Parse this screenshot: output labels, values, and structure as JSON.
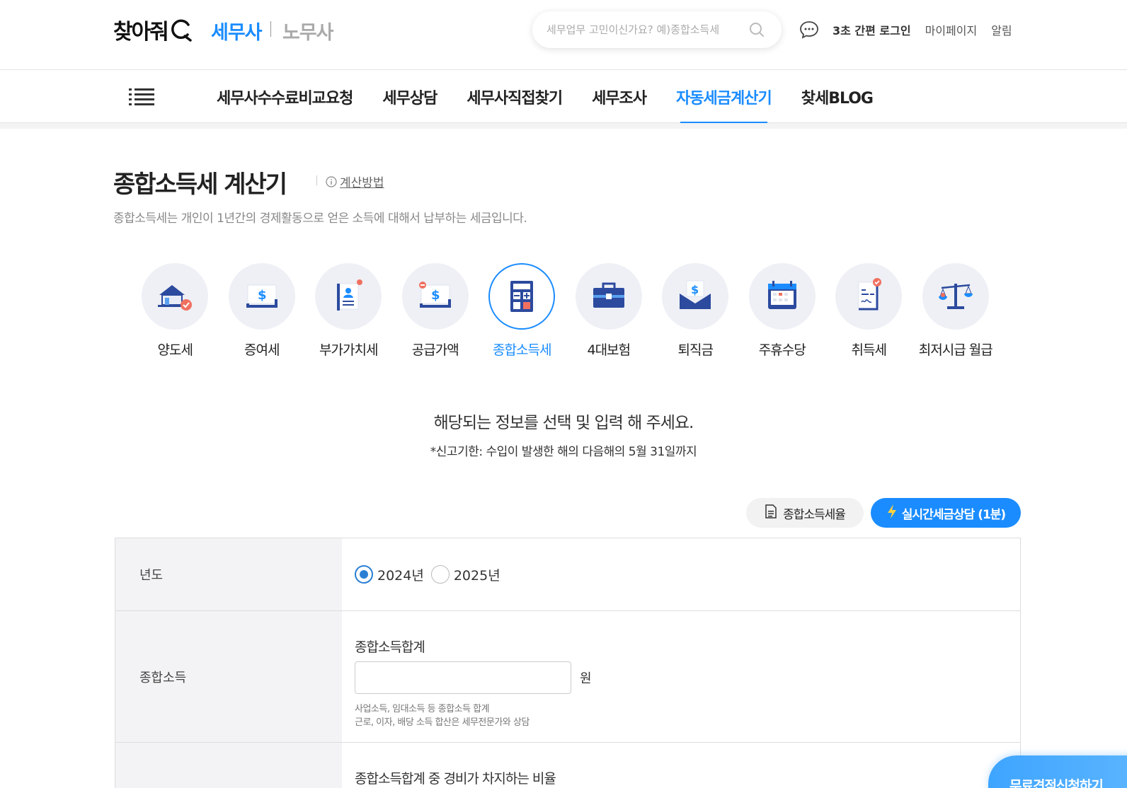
{
  "header": {
    "logo_text": "찾아줘",
    "service_tax": "세무사",
    "service_labor": "노무사",
    "search_placeholder": "세무업무 고민이신가요? 예)종합소득세",
    "login": "3초 간편 로그인",
    "mypage": "마이페이지",
    "alarm": "알림"
  },
  "gnb": {
    "items": [
      {
        "label": "세무사수수료비교요청",
        "active": false
      },
      {
        "label": "세무상담",
        "active": false
      },
      {
        "label": "세무사직접찾기",
        "active": false
      },
      {
        "label": "세무조사",
        "active": false
      },
      {
        "label": "자동세금계산기",
        "active": true
      },
      {
        "label": "찾세BLOG",
        "active": false
      }
    ]
  },
  "page": {
    "title": "종합소득세 계산기",
    "method_link": "계산방법",
    "description": "종합소득세는 개인이 1년간의 경제활동으로 얻은 소득에 대해서 납부하는 세금입니다."
  },
  "calculators": [
    {
      "label": "양도세",
      "icon": "house-icon"
    },
    {
      "label": "증여세",
      "icon": "money-gift-icon"
    },
    {
      "label": "부가가치세",
      "icon": "document-person-icon"
    },
    {
      "label": "공급가액",
      "icon": "money-minus-icon"
    },
    {
      "label": "종합소득세",
      "icon": "calculator-icon",
      "active": true
    },
    {
      "label": "4대보험",
      "icon": "briefcase-icon"
    },
    {
      "label": "퇴직금",
      "icon": "envelope-money-icon"
    },
    {
      "label": "주휴수당",
      "icon": "calendar-icon"
    },
    {
      "label": "취득세",
      "icon": "contract-icon"
    },
    {
      "label": "최저시급 월급",
      "icon": "scale-icon"
    }
  ],
  "notice": {
    "main": "해당되는 정보를 선택 및 입력 해 주세요.",
    "deadline": "*신고기한: 수입이 발생한 해의 다음해의 5월 31일까지"
  },
  "actions": {
    "rate_button": "종합소득세율",
    "consult_button": "실시간세금상담 (1분)"
  },
  "form": {
    "year_label": "년도",
    "year_options": [
      "2024년",
      "2025년"
    ],
    "year_selected": "2024년",
    "income_label": "종합소득",
    "income_field_label": "종합소득합계",
    "income_value": "",
    "income_unit": "원",
    "income_hint_1": "사업소득, 임대소득 등 종합소득 합계",
    "income_hint_2": "근로, 이자, 배당 소득 합산은 세무전문가와 상담",
    "expense_field_label": "종합소득합계 중 경비가 차지하는 비율"
  },
  "float_cta": "무료견적신청하기",
  "colors": {
    "accent": "#1a8cff",
    "radio": "#2a7fd4",
    "icon_bg": "#eef0f5"
  }
}
